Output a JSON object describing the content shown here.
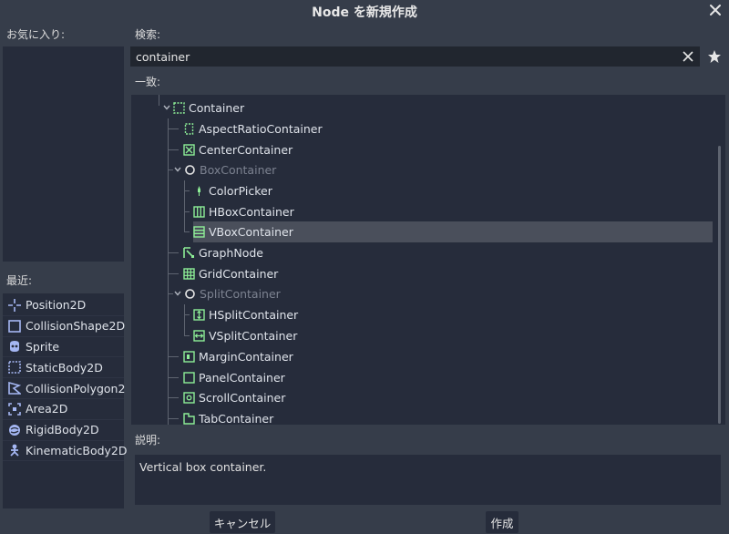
{
  "window": {
    "title": "Node を新規作成"
  },
  "favorites": {
    "label": "お気に入り:"
  },
  "recent": {
    "label": "最近:",
    "items": [
      {
        "label": "Position2D",
        "icon": "position2d-icon"
      },
      {
        "label": "CollisionShape2D",
        "icon": "collisionshape2d-icon"
      },
      {
        "label": "Sprite",
        "icon": "sprite-icon"
      },
      {
        "label": "StaticBody2D",
        "icon": "staticbody2d-icon"
      },
      {
        "label": "CollisionPolygon2",
        "icon": "collisionpolygon2d-icon"
      },
      {
        "label": "Area2D",
        "icon": "area2d-icon"
      },
      {
        "label": "RigidBody2D",
        "icon": "rigidbody2d-icon"
      },
      {
        "label": "KinematicBody2D",
        "icon": "kinematicbody2d-icon"
      }
    ]
  },
  "search": {
    "label": "検索:",
    "value": "container"
  },
  "matches": {
    "label": "一致:",
    "items": [
      {
        "label": "Container",
        "icon": "container-icon",
        "expanded": true
      },
      {
        "label": "AspectRatioContainer",
        "icon": "aspectratiocontainer-icon"
      },
      {
        "label": "CenterContainer",
        "icon": "centercontainer-icon"
      },
      {
        "label": "BoxContainer",
        "icon": "boxcontainer-icon",
        "disabled": true,
        "expanded": true
      },
      {
        "label": "ColorPicker",
        "icon": "colorpicker-icon"
      },
      {
        "label": "HBoxContainer",
        "icon": "hboxcontainer-icon"
      },
      {
        "label": "VBoxContainer",
        "icon": "vboxcontainer-icon",
        "selected": true
      },
      {
        "label": "GraphNode",
        "icon": "graphnode-icon"
      },
      {
        "label": "GridContainer",
        "icon": "gridcontainer-icon"
      },
      {
        "label": "SplitContainer",
        "icon": "splitcontainer-icon",
        "disabled": true,
        "expanded": true
      },
      {
        "label": "HSplitContainer",
        "icon": "hsplitcontainer-icon"
      },
      {
        "label": "VSplitContainer",
        "icon": "vsplitcontainer-icon"
      },
      {
        "label": "MarginContainer",
        "icon": "margincontainer-icon"
      },
      {
        "label": "PanelContainer",
        "icon": "panelcontainer-icon"
      },
      {
        "label": "ScrollContainer",
        "icon": "scrollcontainer-icon"
      },
      {
        "label": "TabContainer",
        "icon": "tabcontainer-icon"
      }
    ]
  },
  "description": {
    "label": "説明:",
    "text": "Vertical box container."
  },
  "buttons": {
    "cancel": "キャンセル",
    "create": "作成"
  },
  "colors": {
    "control_green": "#8eef97",
    "node2d_blue": "#a5b7f3",
    "selection": "#4a4f5b",
    "panel": "#262c3b",
    "background": "#363d4a"
  }
}
